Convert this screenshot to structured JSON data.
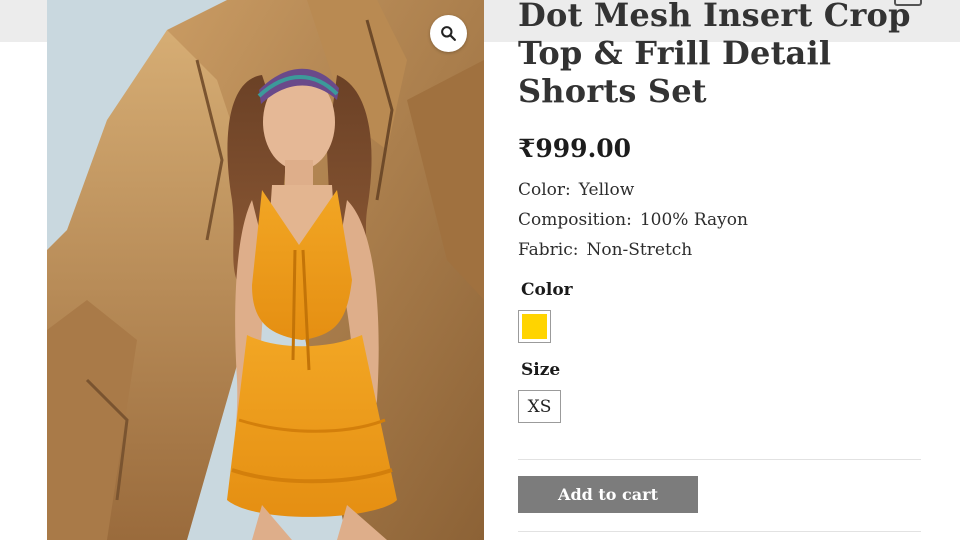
{
  "product": {
    "title": "Dot Mesh Insert Crop Top & Frill Detail Shorts Set",
    "price": "₹999.00",
    "attributes": [
      {
        "label": "Color:",
        "value": "Yellow"
      },
      {
        "label": "Composition:",
        "value": "100% Rayon"
      },
      {
        "label": "Fabric:",
        "value": "Non-Stretch"
      }
    ]
  },
  "options": {
    "color_label": "Color",
    "color_swatch": "#ffd400",
    "size_label": "Size",
    "size_value": "XS"
  },
  "actions": {
    "add_to_cart": "Add to cart"
  },
  "icons": {
    "zoom": "magnifier-icon"
  }
}
